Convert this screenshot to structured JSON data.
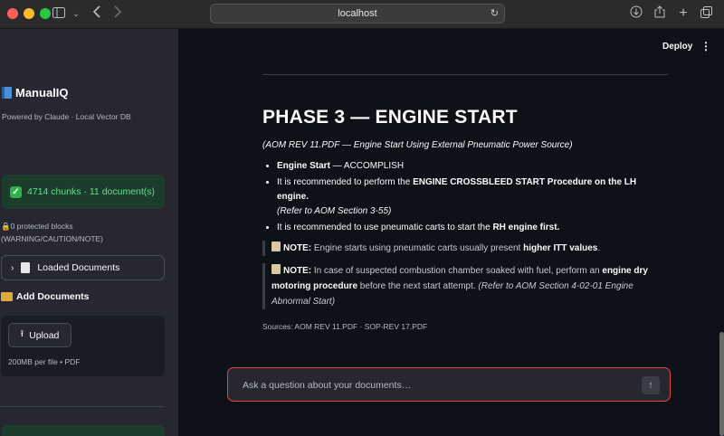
{
  "browser": {
    "url": "localhost",
    "icons": {
      "sidebar_toggle": "sidebar-toggle-icon",
      "back": "chevron-left-icon",
      "forward": "chevron-right-icon",
      "reload": "reload-icon",
      "download": "download-icon",
      "share": "share-icon",
      "new_tab": "plus-icon",
      "tabs": "tab-overview-icon"
    }
  },
  "sidebar": {
    "app_title": "ManualIQ",
    "powered_by": "Powered by Claude · Local Vector DB",
    "status": "4714 chunks · 11 document(s)",
    "protected_line1": "0 protected blocks",
    "protected_line2": "(WARNING/CAUTION/NOTE)",
    "loaded_documents": "Loaded Documents",
    "add_documents": "Add Documents",
    "upload_label": "Upload",
    "upload_limit": "200MB per file • PDF"
  },
  "header": {
    "deploy": "Deploy",
    "menu": "⋮"
  },
  "main": {
    "title": "PHASE 3 — ENGINE START",
    "subtitle": "(AOM REV 11.PDF — Engine Start Using External Pneumatic Power Source)",
    "bullets": [
      {
        "bold": "Engine Start",
        "rest": " — ACCOMPLISH"
      },
      {
        "pre": "It is recommended to perform the ",
        "bold": "ENGINE CROSSBLEED START Procedure on the LH engine.",
        "italic": "(Refer to AOM Section 3-55)"
      },
      {
        "pre": "It is recommended to use pneumatic carts to start the ",
        "bold": "RH engine first."
      }
    ],
    "notes": [
      {
        "label": "NOTE:",
        "pre": " Engine starts using pneumatic carts usually present ",
        "bold": "higher ITT values",
        "post": "."
      },
      {
        "label": "NOTE:",
        "pre": " In case of suspected combustion chamber soaked with fuel, perform an ",
        "bold": "engine dry motoring procedure",
        "post": " before the next start attempt. ",
        "italic": "(Refer to AOM Section 4-02-01 Engine Abnormal Start)"
      }
    ],
    "sources": "Sources: AOM REV 11.PDF · SOP-REV 17.PDF"
  },
  "chat": {
    "placeholder": "Ask a question about your documents…",
    "send": "↑"
  }
}
